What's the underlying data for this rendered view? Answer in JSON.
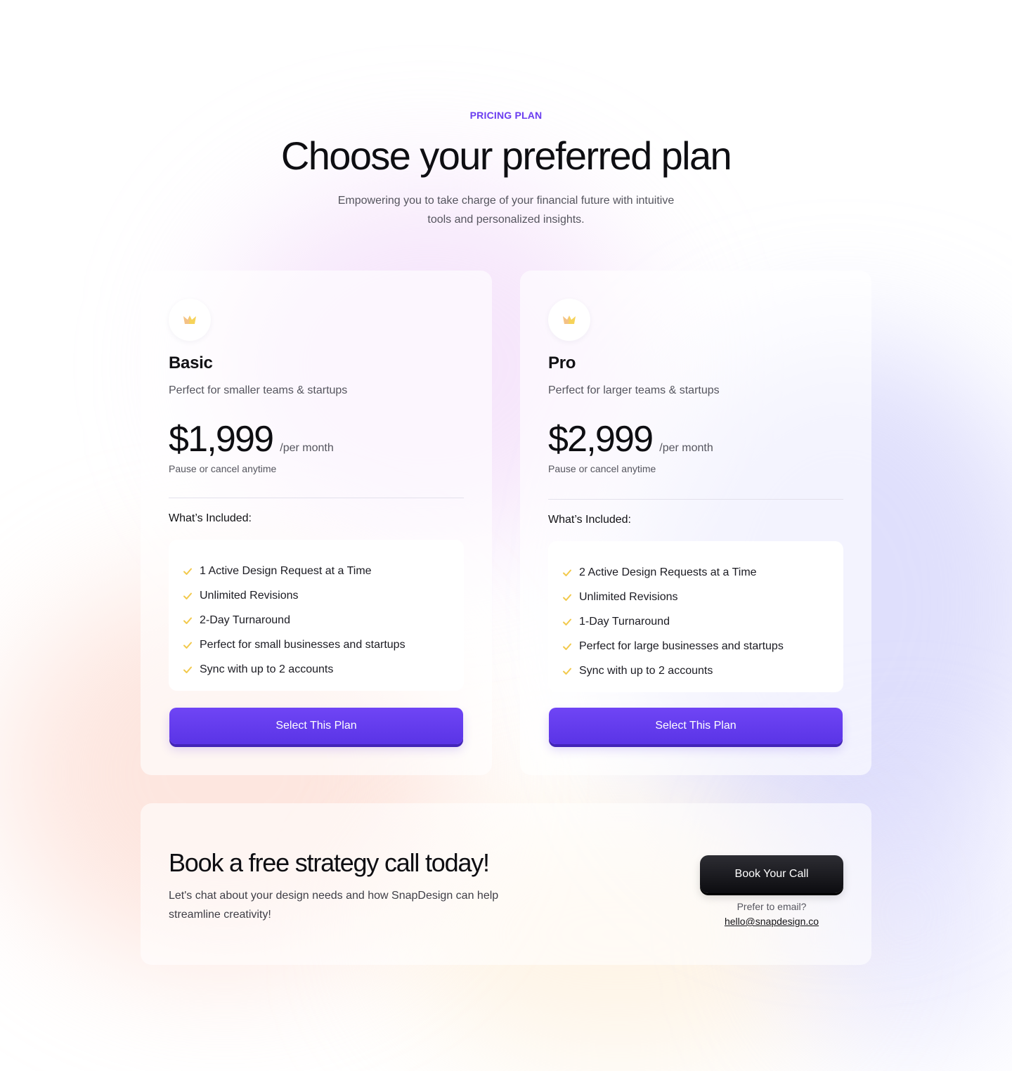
{
  "header": {
    "eyebrow": "PRICING PLAN",
    "title": "Choose your preferred plan",
    "subtitle": "Empowering you to take charge of your financial future with intuitive tools and personalized insights."
  },
  "plans": [
    {
      "name": "Basic",
      "description": "Perfect for smaller teams & startups",
      "price": "$1,999",
      "period": "/per month",
      "note": "Pause or cancel anytime",
      "included_label": "What’s Included:",
      "features": [
        "1 Active Design Request at a Time",
        "Unlimited Revisions",
        "2-Day Turnaround",
        "Perfect for small businesses and startups",
        "Sync with up to 2 accounts"
      ],
      "button_label": "Select This Plan",
      "icon": "crown-icon"
    },
    {
      "name": "Pro",
      "description": "Perfect for larger teams & startups",
      "price": "$2,999",
      "period": "/per month",
      "note": "Pause or cancel anytime",
      "included_label": "What’s Included:",
      "features": [
        "2 Active Design Requests at a Time",
        "Unlimited Revisions",
        "1-Day Turnaround",
        "Perfect for large businesses and startups",
        "Sync with up to 2 accounts"
      ],
      "button_label": "Select This Plan",
      "icon": "crown-icon"
    }
  ],
  "cta": {
    "title": "Book a free strategy call today!",
    "text": "Let's chat about your design needs and how SnapDesign can help streamline creativity!",
    "button_label": "Book Your Call",
    "prefer_label": "Prefer to email?",
    "email": "hello@snapdesign.co"
  },
  "colors": {
    "accent": "#6a3df0",
    "check": "#f2c94c",
    "dark_button": "#111114"
  }
}
